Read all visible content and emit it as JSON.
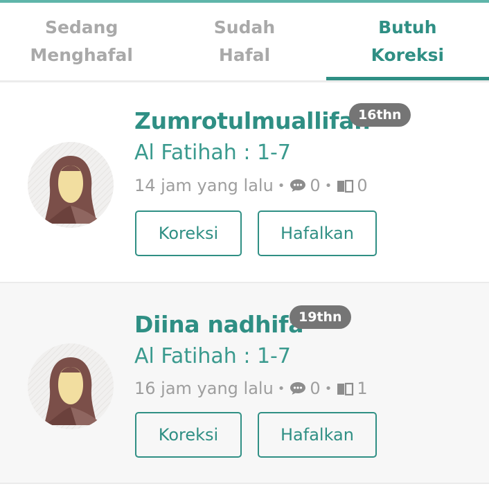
{
  "tabs": [
    {
      "label": "Sedang\nMenghafal",
      "active": false
    },
    {
      "label": "Sudah\nHafal",
      "active": false
    },
    {
      "label": "Butuh\nKoreksi",
      "active": true
    }
  ],
  "accent_color": "#2f8f84",
  "entries": [
    {
      "name": "Zumrotulmuallifah",
      "age": "16thn",
      "surah": "Al Fatihah : 1-7",
      "time": "14 jam yang lalu",
      "comments": "0",
      "reads": "0",
      "avatar_icon": "hijab-avatar-icon",
      "buttons": {
        "correct": "Koreksi",
        "memorize": "Hafalkan"
      }
    },
    {
      "name": "Diina nadhifa",
      "age": "19thn",
      "surah": "Al Fatihah : 1-7",
      "time": "16 jam yang lalu",
      "comments": "0",
      "reads": "1",
      "avatar_icon": "hijab-avatar-icon",
      "buttons": {
        "correct": "Koreksi",
        "memorize": "Hafalkan"
      }
    }
  ],
  "separator": "•"
}
